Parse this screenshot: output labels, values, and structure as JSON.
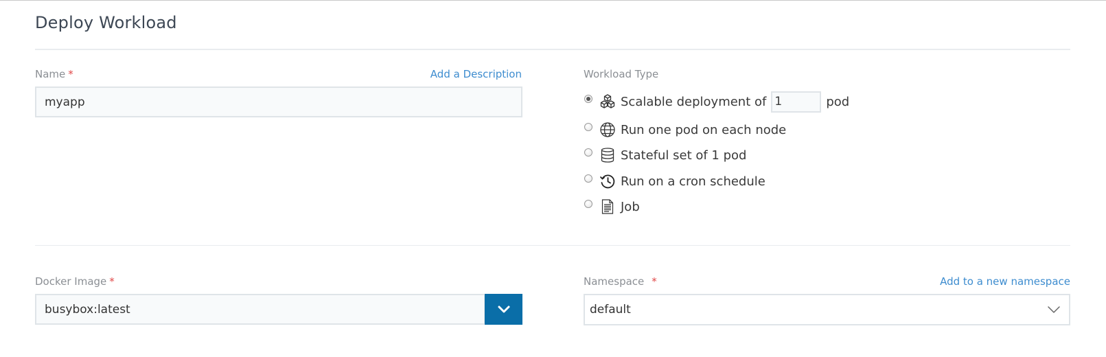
{
  "page": {
    "title": "Deploy Workload"
  },
  "name_field": {
    "label": "Name",
    "required_mark": "*",
    "value": "myapp",
    "add_description_link": "Add a Description"
  },
  "workload_type": {
    "label": "Workload Type",
    "selected": "scalable",
    "options": {
      "scalable": {
        "label_before": "Scalable deployment of",
        "scale_value": "1",
        "label_after": "pod",
        "icon": "cubes-icon"
      },
      "daemonset": {
        "label": "Run one pod on each node",
        "icon": "globe-icon"
      },
      "statefulset": {
        "label": "Stateful set of 1 pod",
        "icon": "database-icon"
      },
      "cronjob": {
        "label": "Run on a cron schedule",
        "icon": "clock-history-icon"
      },
      "job": {
        "label": "Job",
        "icon": "document-icon"
      }
    }
  },
  "docker_image": {
    "label": "Docker Image",
    "required_mark": "*",
    "value": "busybox:latest",
    "dropdown_icon": "chevron-down-icon"
  },
  "namespace": {
    "label": "Namespace",
    "required_mark": "*",
    "value": "default",
    "add_namespace_link": "Add to a new namespace"
  },
  "colors": {
    "accent": "#0a6ea8",
    "link": "#3d8ccf",
    "required": "#e04848",
    "label": "#8b8f94"
  }
}
